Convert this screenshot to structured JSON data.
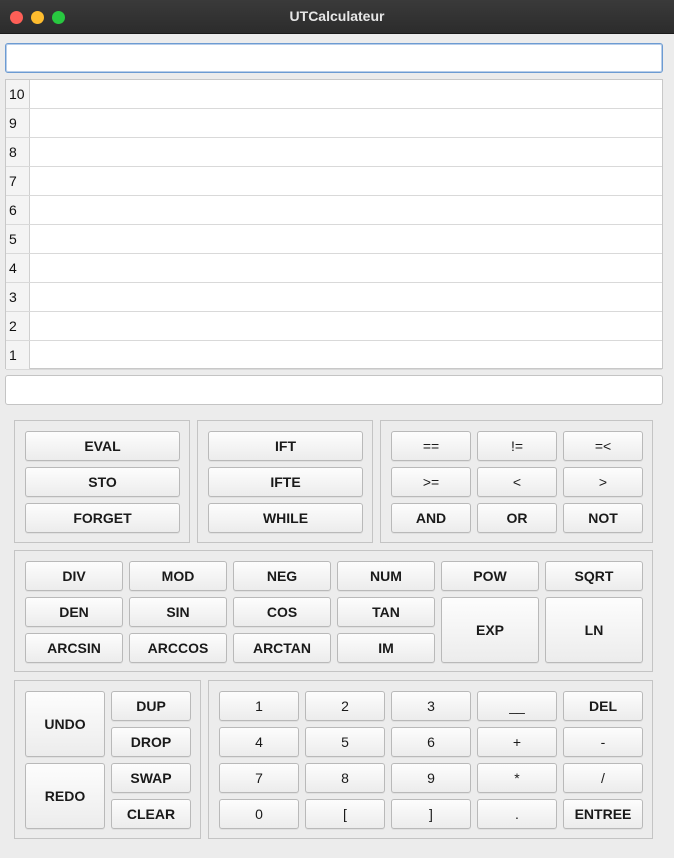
{
  "window": {
    "title": "UTCalculateur"
  },
  "input": {
    "value": ""
  },
  "stack": {
    "indices": [
      "10",
      "9",
      "8",
      "7",
      "6",
      "5",
      "4",
      "3",
      "2",
      "1"
    ],
    "values": [
      "",
      "",
      "",
      "",
      "",
      "",
      "",
      "",
      "",
      ""
    ]
  },
  "message": {
    "text": ""
  },
  "keys": {
    "eval": "EVAL",
    "sto": "STO",
    "forget": "FORGET",
    "ift": "IFT",
    "ifte": "IFTE",
    "while": "WHILE",
    "eq": "==",
    "neq": "!=",
    "le": "=<",
    "ge": ">=",
    "lt": "<",
    "gt": ">",
    "and": "AND",
    "or": "OR",
    "not": "NOT",
    "div": "DIV",
    "mod": "MOD",
    "neg": "NEG",
    "num": "NUM",
    "pow": "POW",
    "sqrt": "SQRT",
    "den": "DEN",
    "sin": "SIN",
    "cos": "COS",
    "tan": "TAN",
    "exp": "EXP",
    "ln": "LN",
    "arcsin": "ARCSIN",
    "arccos": "ARCCOS",
    "arctan": "ARCTAN",
    "im": "IM",
    "undo": "UNDO",
    "redo": "REDO",
    "dup": "DUP",
    "drop": "DROP",
    "swap": "SWAP",
    "clear": "CLEAR",
    "d1": "1",
    "d2": "2",
    "d3": "3",
    "underscore": "__",
    "del": "DEL",
    "d4": "4",
    "d5": "5",
    "d6": "6",
    "plus": "+",
    "minus": "-",
    "d7": "7",
    "d8": "8",
    "d9": "9",
    "mul": "*",
    "slash": "/",
    "d0": "0",
    "lbracket": "[",
    "rbracket": "]",
    "dot": ".",
    "entree": "ENTREE"
  }
}
